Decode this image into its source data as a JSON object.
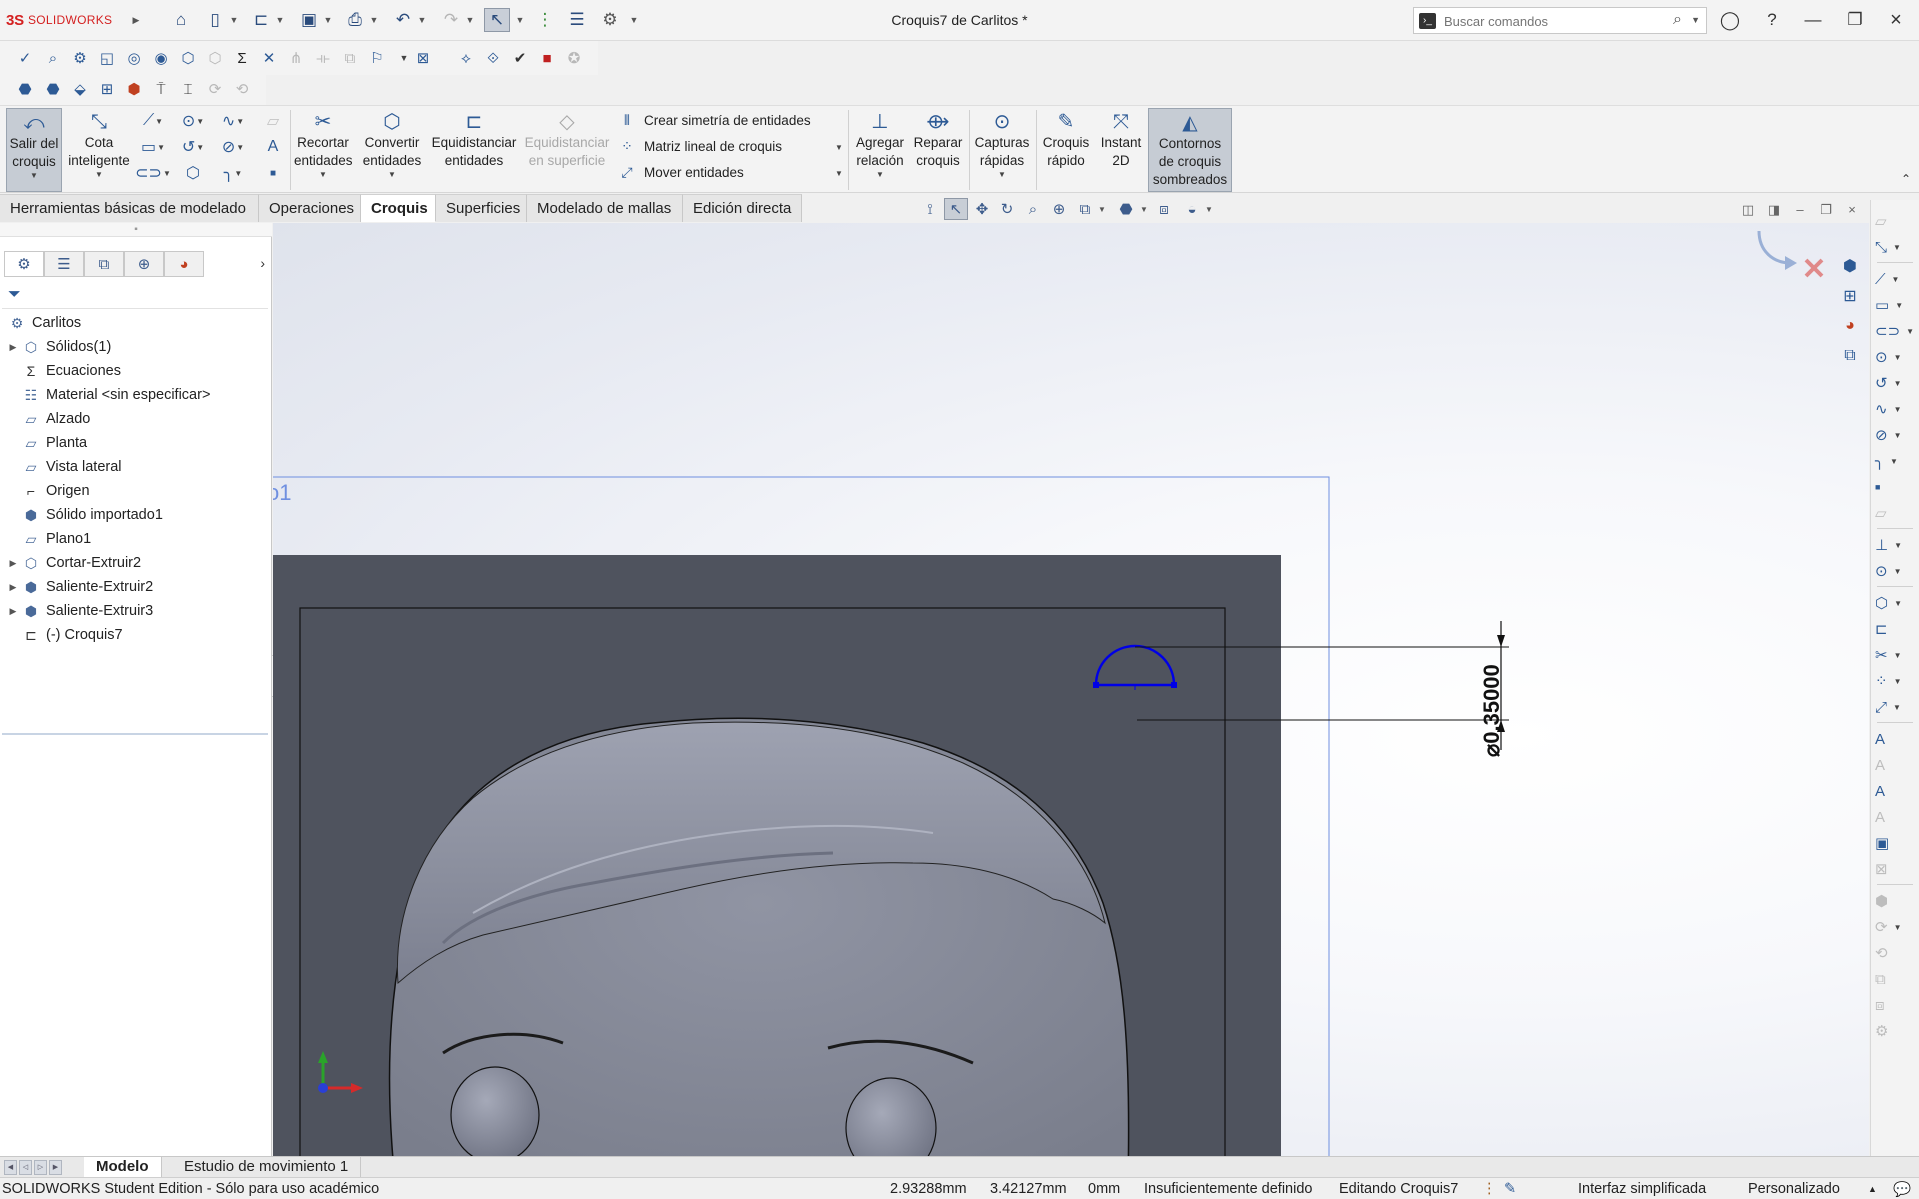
{
  "app": {
    "logo_ds": "3S",
    "logo_text": "SOLIDWORKS",
    "document_title": "Croquis7 de Carlitos *",
    "search_placeholder": "Buscar comandos"
  },
  "command_manager": {
    "exit_sketch": "Salir del\ncroquis",
    "smart_dimension": "Cota\ninteligente",
    "trim": "Recortar\nentidades",
    "convert": "Convertir\nentidades",
    "offset": "Equidistanciar\nentidades",
    "offset_surface": "Equidistanciar\nen superficie",
    "mirror": "Crear simetría de entidades",
    "linear_pattern": "Matriz lineal de croquis",
    "move": "Mover entidades",
    "add_relation": "Agregar\nrelación",
    "repair": "Reparar\ncroquis",
    "quick_snaps": "Capturas\nrápidas",
    "rapid_sketch": "Croquis\nrápido",
    "instant2d": "Instant\n2D",
    "shaded_contours": "Contornos\nde croquis\nsombreados"
  },
  "tabs": [
    {
      "label": "Herramientas básicas de modelado"
    },
    {
      "label": "Operaciones"
    },
    {
      "label": "Croquis"
    },
    {
      "label": "Superficies"
    },
    {
      "label": "Modelado de mallas"
    },
    {
      "label": "Edición directa"
    }
  ],
  "tree": {
    "root": "Carlitos",
    "items": [
      {
        "label": "Sólidos(1)"
      },
      {
        "label": "Ecuaciones"
      },
      {
        "label": "Material <sin especificar>"
      },
      {
        "label": "Alzado"
      },
      {
        "label": "Planta"
      },
      {
        "label": "Vista lateral"
      },
      {
        "label": "Origen"
      },
      {
        "label": "Sólido importado1"
      },
      {
        "label": "Plano1"
      },
      {
        "label": "Cortar-Extruir2"
      },
      {
        "label": "Saliente-Extruir2"
      },
      {
        "label": "Saliente-Extruir3"
      },
      {
        "label": "(-) Croquis7"
      }
    ]
  },
  "viewport": {
    "plane_label": "o1",
    "dimension_text": "⌀0.35000"
  },
  "bottom_tabs": [
    {
      "label": "Modelo"
    },
    {
      "label": "Estudio de movimiento 1"
    }
  ],
  "status": {
    "edition": "SOLIDWORKS Student Edition - Sólo para uso académico",
    "x": "2.93288mm",
    "y": "3.42127mm",
    "z": "0mm",
    "definition": "Insuficientemente definido",
    "editing": "Editando Croquis7",
    "interface": "Interfaz simplificada",
    "units": "Personalizado"
  },
  "colors": {
    "accent": "#2d5a95",
    "model_gray": "#4f535e",
    "sketch_blue": "#0000e6",
    "logo_red": "#d42020"
  }
}
